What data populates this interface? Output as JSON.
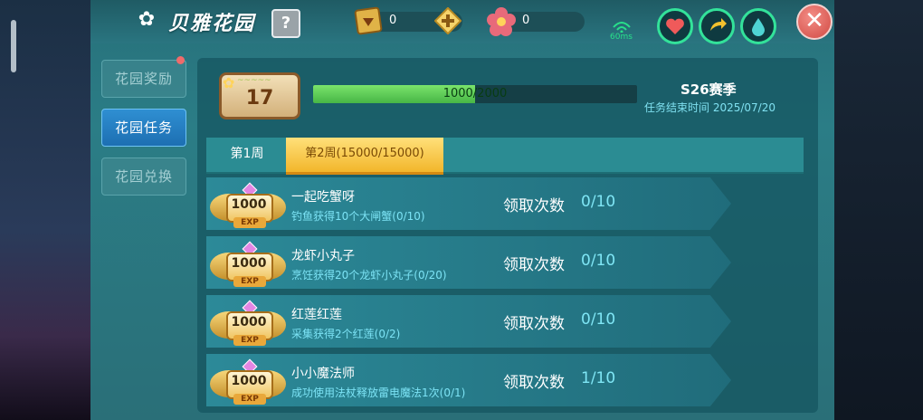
{
  "header": {
    "title": "贝雅花园",
    "help_label": "?",
    "gem_count": "0",
    "flower_count": "0",
    "signal_label": "60ms",
    "close_label": "✕"
  },
  "sidebar": {
    "items": [
      {
        "label": "花园奖励"
      },
      {
        "label": "花园任务"
      },
      {
        "label": "花园兑换"
      }
    ]
  },
  "level": {
    "value": "17",
    "progress_text": "1000/2000",
    "progress_fraction": 0.5
  },
  "season": {
    "name": "S26赛季",
    "end_text": "任务结束时间 2025/07/20"
  },
  "weeks": [
    {
      "label": "第1周"
    },
    {
      "label": "第2周(15000/15000)"
    }
  ],
  "tasks": [
    {
      "reward": "1000",
      "exp": "EXP",
      "name": "一起吃蟹呀",
      "desc": "钓鱼获得10个大闸蟹(0/10)",
      "claim_label": "领取次数",
      "claim_value": "0/10"
    },
    {
      "reward": "1000",
      "exp": "EXP",
      "name": "龙虾小丸子",
      "desc": "烹饪获得20个龙虾小丸子(0/20)",
      "claim_label": "领取次数",
      "claim_value": "0/10"
    },
    {
      "reward": "1000",
      "exp": "EXP",
      "name": "红莲红莲",
      "desc": "采集获得2个红莲(0/2)",
      "claim_label": "领取次数",
      "claim_value": "0/10"
    },
    {
      "reward": "1000",
      "exp": "EXP",
      "name": "小小魔法师",
      "desc": "成功使用法杖释放雷电魔法1次(0/1)",
      "claim_label": "领取次数",
      "claim_value": "1/10"
    }
  ],
  "colors": {
    "accent": "#33e29a",
    "active_tab": "#2f8fd2",
    "week_active": "#f2b62b",
    "close": "#d14a43"
  }
}
